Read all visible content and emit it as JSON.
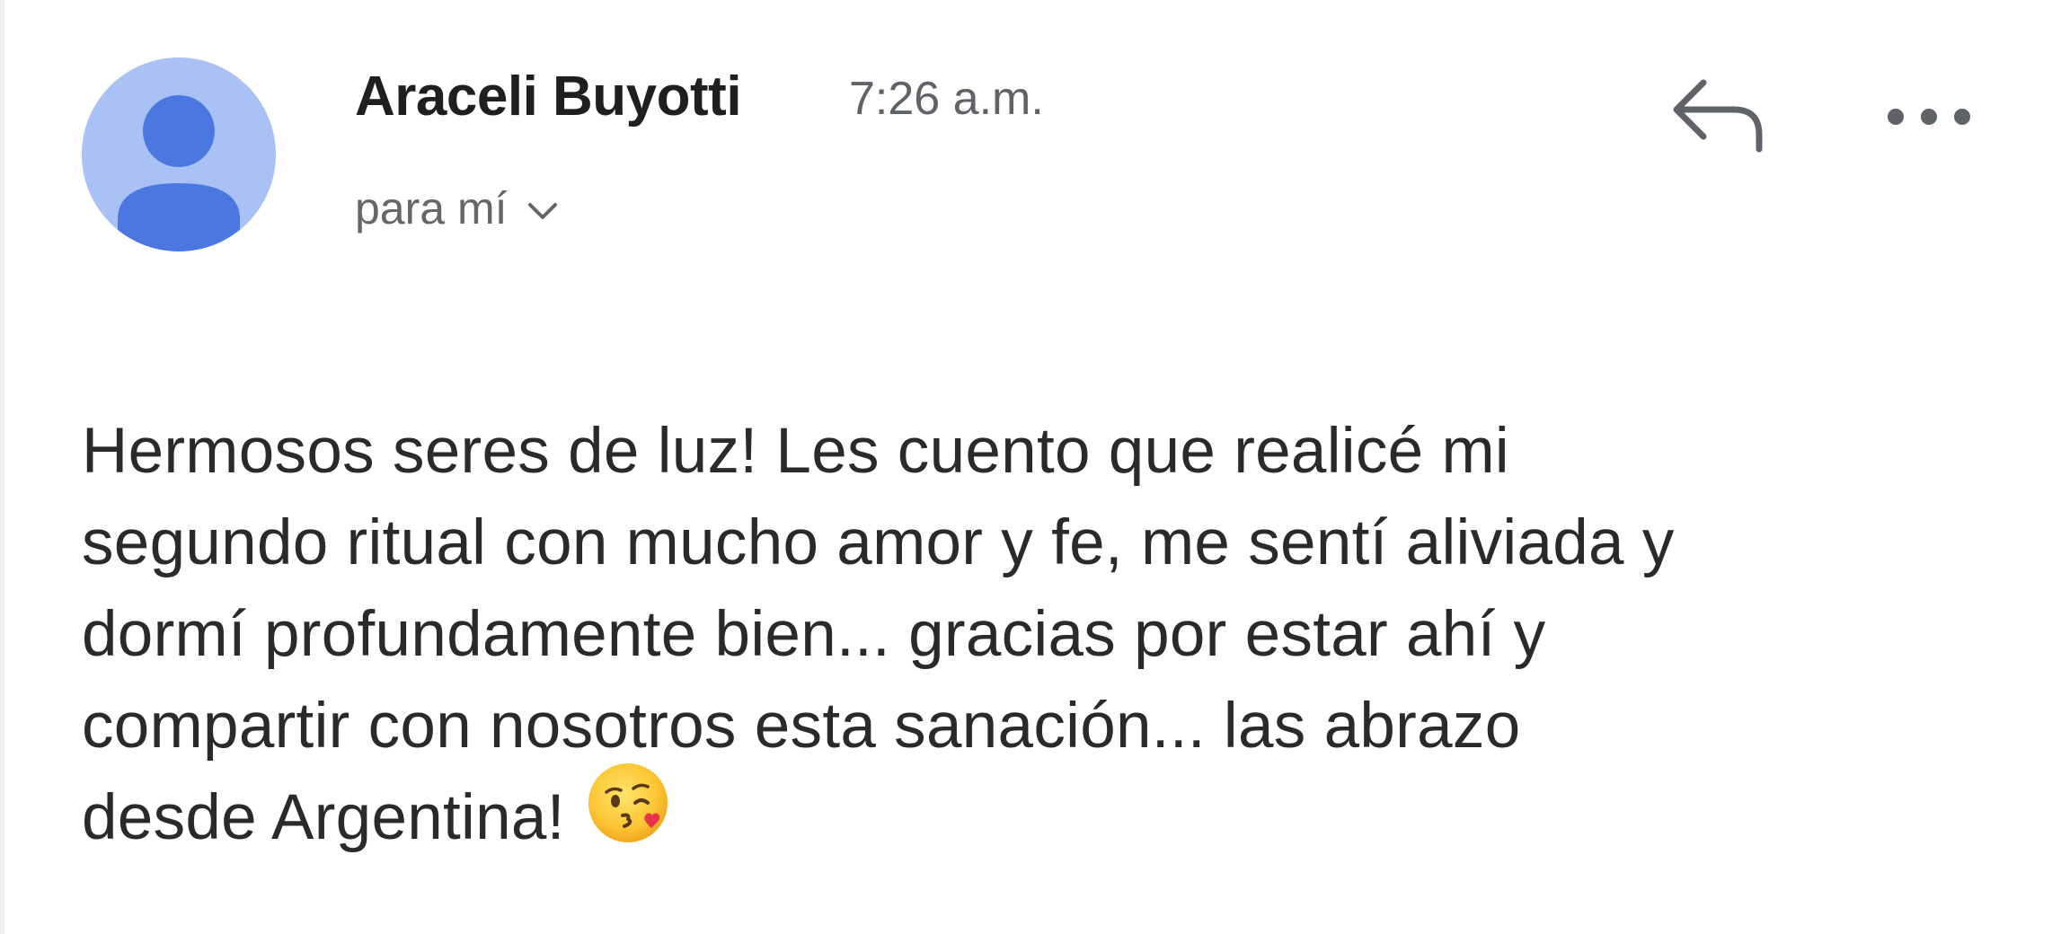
{
  "email": {
    "sender_name": "Araceli Buyotti",
    "time": "7:26 a.m.",
    "recipient_label": "para mí",
    "body_lines": [
      "Hermosos seres de luz! Les cuento que realicé mi",
      "segundo ritual con mucho amor y fe, me sentí aliviada y",
      "dormí profundamente bien... gracias por estar ahí y",
      "compartir con nosotros esta sanación... las abrazo",
      "desde Argentina!"
    ],
    "body_emoji": "face-blowing-a-kiss-icon"
  },
  "icons": {
    "avatar": "default-person-avatar-icon",
    "reply": "reply-icon",
    "more": "more-horizontal-icon",
    "expand": "chevron-down-icon"
  },
  "colors": {
    "avatar_background": "#a9c1f5",
    "avatar_figure": "#4a78e0",
    "icon_gray": "#5f6368",
    "text_primary": "#1f1f1f"
  }
}
